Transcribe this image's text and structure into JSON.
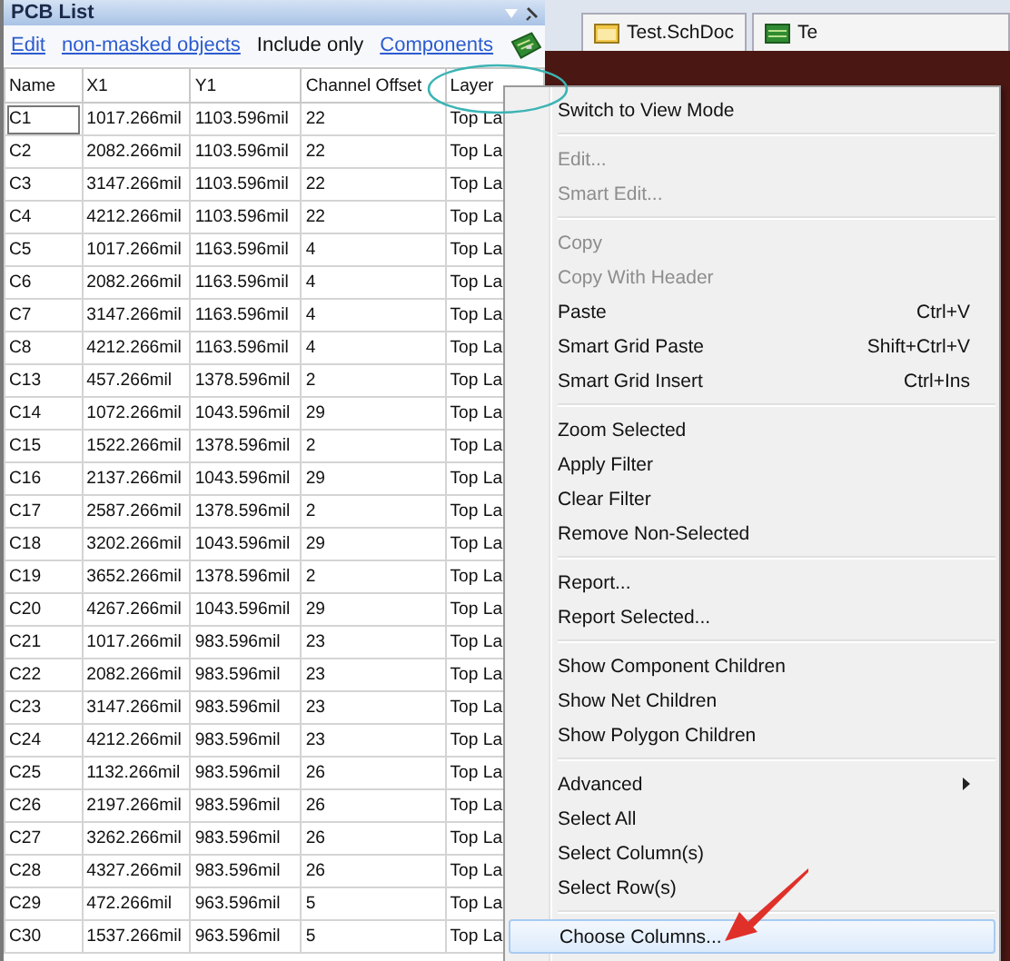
{
  "panel": {
    "title": "PCB List",
    "toolbar": [
      {
        "kind": "link",
        "text": "Edit"
      },
      {
        "kind": "link",
        "text": "non-masked objects"
      },
      {
        "kind": "text",
        "text": "Include only"
      },
      {
        "kind": "link",
        "text": "Components"
      }
    ]
  },
  "document_tabs": [
    {
      "label": "Test.SchDoc",
      "kind": "schematic"
    },
    {
      "label": "Te",
      "kind": "pcb"
    }
  ],
  "table": {
    "columns": [
      "Name",
      "X1",
      "Y1",
      "Channel Offset",
      "Layer"
    ],
    "rows": [
      {
        "cells": [
          "C1",
          "1017.266mil",
          "1103.596mil",
          "22",
          "Top La"
        ],
        "focused": true
      },
      {
        "cells": [
          "C2",
          "2082.266mil",
          "1103.596mil",
          "22",
          "Top La"
        ],
        "focused": false
      },
      {
        "cells": [
          "C3",
          "3147.266mil",
          "1103.596mil",
          "22",
          "Top La"
        ],
        "focused": false
      },
      {
        "cells": [
          "C4",
          "4212.266mil",
          "1103.596mil",
          "22",
          "Top La"
        ],
        "focused": false
      },
      {
        "cells": [
          "C5",
          "1017.266mil",
          "1163.596mil",
          "4",
          "Top La"
        ],
        "focused": false
      },
      {
        "cells": [
          "C6",
          "2082.266mil",
          "1163.596mil",
          "4",
          "Top La"
        ],
        "focused": false
      },
      {
        "cells": [
          "C7",
          "3147.266mil",
          "1163.596mil",
          "4",
          "Top La"
        ],
        "focused": false
      },
      {
        "cells": [
          "C8",
          "4212.266mil",
          "1163.596mil",
          "4",
          "Top La"
        ],
        "focused": false
      },
      {
        "cells": [
          "C13",
          "457.266mil",
          "1378.596mil",
          "2",
          "Top La"
        ],
        "focused": false
      },
      {
        "cells": [
          "C14",
          "1072.266mil",
          "1043.596mil",
          "29",
          "Top La"
        ],
        "focused": false
      },
      {
        "cells": [
          "C15",
          "1522.266mil",
          "1378.596mil",
          "2",
          "Top La"
        ],
        "focused": false
      },
      {
        "cells": [
          "C16",
          "2137.266mil",
          "1043.596mil",
          "29",
          "Top La"
        ],
        "focused": false
      },
      {
        "cells": [
          "C17",
          "2587.266mil",
          "1378.596mil",
          "2",
          "Top La"
        ],
        "focused": false
      },
      {
        "cells": [
          "C18",
          "3202.266mil",
          "1043.596mil",
          "29",
          "Top La"
        ],
        "focused": false
      },
      {
        "cells": [
          "C19",
          "3652.266mil",
          "1378.596mil",
          "2",
          "Top La"
        ],
        "focused": false
      },
      {
        "cells": [
          "C20",
          "4267.266mil",
          "1043.596mil",
          "29",
          "Top La"
        ],
        "focused": false
      },
      {
        "cells": [
          "C21",
          "1017.266mil",
          "983.596mil",
          "23",
          "Top La"
        ],
        "focused": false
      },
      {
        "cells": [
          "C22",
          "2082.266mil",
          "983.596mil",
          "23",
          "Top La"
        ],
        "focused": false
      },
      {
        "cells": [
          "C23",
          "3147.266mil",
          "983.596mil",
          "23",
          "Top La"
        ],
        "focused": false
      },
      {
        "cells": [
          "C24",
          "4212.266mil",
          "983.596mil",
          "23",
          "Top La"
        ],
        "focused": false
      },
      {
        "cells": [
          "C25",
          "1132.266mil",
          "983.596mil",
          "26",
          "Top La"
        ],
        "focused": false
      },
      {
        "cells": [
          "C26",
          "2197.266mil",
          "983.596mil",
          "26",
          "Top La"
        ],
        "focused": false
      },
      {
        "cells": [
          "C27",
          "3262.266mil",
          "983.596mil",
          "26",
          "Top La"
        ],
        "focused": false
      },
      {
        "cells": [
          "C28",
          "4327.266mil",
          "983.596mil",
          "26",
          "Top La"
        ],
        "focused": false
      },
      {
        "cells": [
          "C29",
          "472.266mil",
          "963.596mil",
          "5",
          "Top La"
        ],
        "focused": false
      },
      {
        "cells": [
          "C30",
          "1537.266mil",
          "963.596mil",
          "5",
          "Top La"
        ],
        "focused": false
      }
    ]
  },
  "context_menu": [
    {
      "kind": "item",
      "label": "Switch to View Mode",
      "disabled": false,
      "highlighted": false,
      "submenu": false
    },
    {
      "kind": "separator"
    },
    {
      "kind": "item",
      "label": "Edit...",
      "disabled": true,
      "highlighted": false,
      "submenu": false
    },
    {
      "kind": "item",
      "label": "Smart Edit...",
      "disabled": true,
      "highlighted": false,
      "submenu": false
    },
    {
      "kind": "separator"
    },
    {
      "kind": "item",
      "label": "Copy",
      "disabled": true,
      "highlighted": false,
      "submenu": false
    },
    {
      "kind": "item",
      "label": "Copy With Header",
      "disabled": true,
      "highlighted": false,
      "submenu": false
    },
    {
      "kind": "item",
      "label": "Paste",
      "shortcut": "Ctrl+V",
      "disabled": false,
      "highlighted": false,
      "submenu": false
    },
    {
      "kind": "item",
      "label": "Smart Grid Paste",
      "shortcut": "Shift+Ctrl+V",
      "disabled": false,
      "highlighted": false,
      "submenu": false
    },
    {
      "kind": "item",
      "label": "Smart Grid Insert",
      "shortcut": "Ctrl+Ins",
      "disabled": false,
      "highlighted": false,
      "submenu": false
    },
    {
      "kind": "separator"
    },
    {
      "kind": "item",
      "label": "Zoom Selected",
      "disabled": false,
      "highlighted": false,
      "submenu": false
    },
    {
      "kind": "item",
      "label": "Apply Filter",
      "disabled": false,
      "highlighted": false,
      "submenu": false
    },
    {
      "kind": "item",
      "label": "Clear Filter",
      "disabled": false,
      "highlighted": false,
      "submenu": false
    },
    {
      "kind": "item",
      "label": "Remove Non-Selected",
      "disabled": false,
      "highlighted": false,
      "submenu": false
    },
    {
      "kind": "separator"
    },
    {
      "kind": "item",
      "label": "Report...",
      "disabled": false,
      "highlighted": false,
      "submenu": false
    },
    {
      "kind": "item",
      "label": "Report Selected...",
      "disabled": false,
      "highlighted": false,
      "submenu": false
    },
    {
      "kind": "separator"
    },
    {
      "kind": "item",
      "label": "Show Component Children",
      "disabled": false,
      "highlighted": false,
      "submenu": false
    },
    {
      "kind": "item",
      "label": "Show Net Children",
      "disabled": false,
      "highlighted": false,
      "submenu": false
    },
    {
      "kind": "item",
      "label": "Show Polygon Children",
      "disabled": false,
      "highlighted": false,
      "submenu": false
    },
    {
      "kind": "separator"
    },
    {
      "kind": "item",
      "label": "Advanced",
      "disabled": false,
      "highlighted": false,
      "submenu": true
    },
    {
      "kind": "item",
      "label": "Select All",
      "disabled": false,
      "highlighted": false,
      "submenu": false
    },
    {
      "kind": "item",
      "label": "Select Column(s)",
      "disabled": false,
      "highlighted": false,
      "submenu": false
    },
    {
      "kind": "item",
      "label": "Select Row(s)",
      "disabled": false,
      "highlighted": false,
      "submenu": false
    },
    {
      "kind": "separator"
    },
    {
      "kind": "item",
      "label": "Choose Columns...",
      "disabled": false,
      "highlighted": true,
      "submenu": false
    }
  ]
}
